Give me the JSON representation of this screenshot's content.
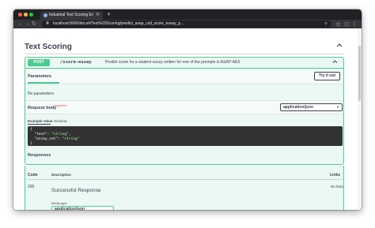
{
  "browser": {
    "tab_title": "Industrial Text Scoring Engine",
    "tab_close": "✕",
    "new_tab": "+",
    "url": "localhost:8000/docs#/Text%20Scoring/predict_asap_call_score_essay_p...",
    "nav": {
      "back": "←",
      "forward": "→",
      "reload": "↻"
    }
  },
  "section": {
    "title": "Text Scoring",
    "collapse_glyph": "⌃"
  },
  "operation": {
    "method": "POST",
    "path": "/score-essay",
    "description": "Predict score for a student essay written for one of the prompts in ASAP-AES",
    "chevron": "⌃",
    "parameters_label": "Parameters",
    "try_label": "Try it out",
    "no_params": "No parameters",
    "request_body_label": "Request body",
    "required_label": "required",
    "content_type": "application/json",
    "example_tab": "Example Value",
    "schema_tab": "Schema",
    "code_lines": {
      "l1": "{",
      "k2": "  \"text\": ",
      "v2": "\"string\",",
      "k3": "  \"essay_set\": ",
      "v3": "\"string\"",
      "l4": "}"
    }
  },
  "responses": {
    "label": "Responses",
    "columns": {
      "code": "Code",
      "description": "Description",
      "links": "Links"
    },
    "rows": [
      {
        "code": "200",
        "description": "Successful Response",
        "links": "No links",
        "media_type_label": "Media type",
        "media_type": "application/json"
      }
    ]
  },
  "colors": {
    "post_green": "#49cc90",
    "op_bg": "#ecf8f3",
    "text": "#3b4151",
    "code_bg": "#333333"
  }
}
